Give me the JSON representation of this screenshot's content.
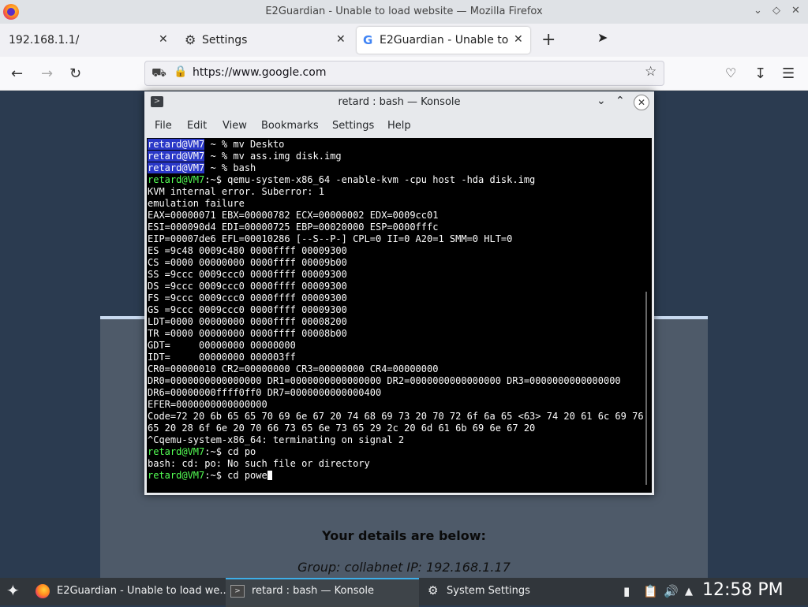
{
  "window": {
    "title": "E2Guardian - Unable to load website — Mozilla Firefox"
  },
  "tabs": [
    {
      "label": "192.168.1.1/",
      "icon": "none"
    },
    {
      "label": "Settings",
      "icon": "gear-icon"
    },
    {
      "label": "E2Guardian - Unable to load website",
      "icon": "google-icon",
      "active": true
    }
  ],
  "navbar": {
    "url": "https://www.google.com"
  },
  "page": {
    "details_title": "Your details are below:",
    "details_line": "Group: collabnet   IP: 192.168.1.17"
  },
  "konsole": {
    "title": "retard : bash — Konsole",
    "menu": [
      "File",
      "Edit",
      "View",
      "Bookmarks",
      "Settings",
      "Help"
    ],
    "lines": [
      {
        "user": "retard@VM7",
        "style": "hl",
        "rest": " ~ % mv Deskto"
      },
      {
        "user": "retard@VM7",
        "style": "hl",
        "rest": " ~ % mv ass.img disk.img"
      },
      {
        "user": "retard@VM7",
        "style": "hl",
        "rest": " ~ % bash"
      },
      {
        "user": "retard@VM7",
        "style": "g",
        "rest": ":~$ qemu-system-x86_64 -enable-kvm -cpu host -hda disk.img"
      },
      {
        "text": "KVM internal error. Suberror: 1"
      },
      {
        "text": "emulation failure"
      },
      {
        "text": "EAX=00000071 EBX=00000782 ECX=00000002 EDX=0009cc01"
      },
      {
        "text": "ESI=000090d4 EDI=00000725 EBP=00020000 ESP=0000fffc"
      },
      {
        "text": "EIP=00007de6 EFL=00010286 [--S--P-] CPL=0 II=0 A20=1 SMM=0 HLT=0"
      },
      {
        "text": "ES =9c48 0009c480 0000ffff 00009300"
      },
      {
        "text": "CS =0000 00000000 0000ffff 00009b00"
      },
      {
        "text": "SS =9ccc 0009ccc0 0000ffff 00009300"
      },
      {
        "text": "DS =9ccc 0009ccc0 0000ffff 00009300"
      },
      {
        "text": "FS =9ccc 0009ccc0 0000ffff 00009300"
      },
      {
        "text": "GS =9ccc 0009ccc0 0000ffff 00009300"
      },
      {
        "text": "LDT=0000 00000000 0000ffff 00008200"
      },
      {
        "text": "TR =0000 00000000 0000ffff 00008b00"
      },
      {
        "text": "GDT=     00000000 00000000"
      },
      {
        "text": "IDT=     00000000 000003ff"
      },
      {
        "text": "CR0=00000010 CR2=00000000 CR3=00000000 CR4=00000000"
      },
      {
        "text": "DR0=0000000000000000 DR1=0000000000000000 DR2=0000000000000000 DR3=0000000000000000"
      },
      {
        "text": "DR6=00000000ffff0ff0 DR7=0000000000000400"
      },
      {
        "text": "EFER=0000000000000000"
      },
      {
        "text": "Code=72 20 6b 65 65 70 69 6e 67 20 74 68 69 73 20 70 72 6f 6a 65 <63> 74 20 61 6c 69 76"
      },
      {
        "text": "65 20 28 6f 6e 20 70 66 73 65 6e 73 65 29 2c 20 6d 61 6b 69 6e 67 20"
      },
      {
        "text": "^Cqemu-system-x86_64: terminating on signal 2"
      },
      {
        "user": "retard@VM7",
        "style": "g",
        "rest": ":~$ cd po"
      },
      {
        "text": "bash: cd: po: No such file or directory"
      },
      {
        "user": "retard@VM7",
        "style": "g",
        "rest": ":~$ cd powe",
        "cursor": true
      }
    ]
  },
  "taskbar": {
    "tasks": [
      {
        "label": "E2Guardian - Unable to load we...",
        "icon": "firefox-icon"
      },
      {
        "label": "retard : bash — Konsole",
        "icon": "konsole-icon",
        "active": true
      },
      {
        "label": "System Settings",
        "icon": "settings-icon"
      }
    ],
    "clock": "12:58 PM"
  },
  "colors": {
    "terminal_bg": "#000000",
    "prompt_green": "#54ff54",
    "user_highlight": "#2a38c8",
    "accent": "#3daee9"
  }
}
